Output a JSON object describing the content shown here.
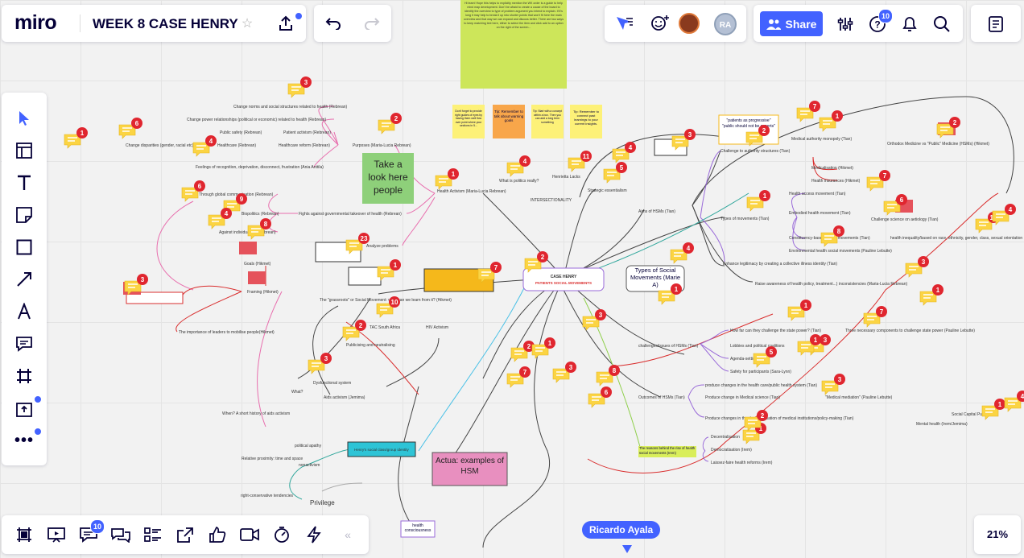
{
  "app": {
    "logo": "miro",
    "board_title": "WEEK 8 CASE HENRY",
    "zoom": "21%"
  },
  "top_right": {
    "share_label": "Share",
    "help_badge": "10",
    "avatar_initials": "RA"
  },
  "bottom_toolbar": {
    "comments_badge": "10"
  },
  "cursor": {
    "user": "Ricardo Ayala"
  },
  "left_toolbar": [
    "select-tool",
    "templates-tool",
    "text-tool",
    "sticky-note-tool",
    "shape-tool",
    "connection-line-tool",
    "pen-tool",
    "comment-tool",
    "frame-tool",
    "upload-tool",
    "more-tools"
  ],
  "board": {
    "center_title": "CASE HENRY",
    "center_subtitle": "PATIENTS SOCIAL MOVEMENTS",
    "green_note": "Take a look here people",
    "types_note": "Types of Social Movements (Marie A)",
    "actua_note": "Actua: examples of HSM",
    "privilege": "Privilege",
    "health_consciousness": "health consciousness",
    "henry_identity": "Henry's social class/group identity",
    "framing": "Framing (Hikmet)",
    "goals": "Goals (Hikmet)",
    "aids_activism": "Aids activism (Jemima)",
    "tac": "TAC South Africa",
    "hiv_activism": "HIV Activism",
    "publicising": "Publicising and neutralising",
    "dysfunctional": "Dysfunctional system",
    "analyze_problems": "Analyze problems",
    "intersectionality": "INTERSECTIONALITY",
    "strategic": "Strategic essentialism",
    "health_activism": "Health Activism (Maria-Lucia Rebrean)",
    "what_is_politics": "What is politics really?",
    "purposes": "Purposes (Maria-Lucia Rebrean)",
    "fights_against": "Fights against governmental takeover of health (Rebrean)",
    "grassroots": "The \"grassroots\" or Social Movement: what can we learn from it? (Hikmet)",
    "aims_hsm": "Aims of HSMs (Tian)",
    "types_movements": "Types of movements (Tian)",
    "challenges_hsm": "challenges/issues of HSMs (Tian)",
    "outcomes_hsm": "Outcomes of HSMs (Tian)",
    "challenge_authority": "Challenge to authority structures (Tian)",
    "orthodox": "Orthodox Medicine vs \"Public\" Medicine (HSMs) (Hikmet)",
    "medical_monopoly": "Medical authority monopoly (Tian)",
    "medicalisation": "Medicalisation (Hikmet)",
    "health_insurances": "Health insurances (Hikmet)",
    "health_access": "Health access movement (Tian)",
    "embodied": "Embodied health movement (Tian)",
    "constituency": "Constituency-based health movements (Tian)",
    "environmental": "Environmental health social movements (Pauline Lebutte)",
    "enhance_legitimacy": "Enhance legitimacy by creating a collective illness identity (Tian)",
    "raise_awareness": "Raise awareness of health policy, treatment...) inconsistencies (Maria-Lucia Rebrean)",
    "how_challenge_state": "How far can they challenge the state power? (Tian)",
    "three_components": "Three necessary components to challenge state power (Pauline Lebutte)",
    "lobbies": "Lobbies and political coalitions",
    "agenda": "Agenda-setting",
    "safety": "Safety for participants (Sara-Lynn)",
    "produce_public": "produce changes in the health care/public health system (Tian)",
    "produce_medical": "Produce change in Medical science (Tian)",
    "produce_policy": "Produce changes in the decentralisation of medical institutions/policy-making (Tian)",
    "decentralisation": "Decentralisation",
    "democratisation": "Democratisation (Irem)",
    "laissez_faire": "Laissez-faire health reforms (Irem)",
    "medical_mediation": "\"Medical mediation\" (Pauline Lebutte)",
    "reasons_behind": "The reasons behind the rise of health social movements (Irem)",
    "challenge_science": "Challenge science on aetiology (Tian)",
    "health_inequality": "health inequality/based on race, ethnicity, gender, class, sexual orientation",
    "mental_health": "Mental health (Irem/Jemima)",
    "social_capital": "Social Capital Putnam",
    "patient_progressive": "\"patients as progressive\" \"public should not be experts\"",
    "change_norms": "Change norms and social structures related to health (Rebrean)",
    "change_power": "Change power relationships (political or economic) related to health (Rebrean)",
    "public_safety": "Public safety (Rebrean)",
    "patient_activism": "Patient activism (Rebrean)",
    "healthcare_rebrean": "Healthcare (Rebrean)",
    "healthcare_reform": "Healthcare reform (Rebrean)",
    "feelings": "Feelings of recognition, deprivation, disconnect, frustration (Ania Anttila)",
    "change_disparities": "Change disparities (gender, racial etc)",
    "importance_leaders": "The importance of leaders to mobilise people(Hikmet)",
    "when_aids": "When? A short history of aids activism",
    "what_q": "What?",
    "relative_proximity": "Relative proximity: time and space",
    "nonactivism": "nonactivism",
    "political_apathy": "political apathy",
    "right_conservative": "right-conservative tendencies",
    "henriettas": "Henrietta Lacks",
    "biopolitics": "Biopolitics (Rebrean)",
    "against_individualism": "Against individualism (Rebrean)",
    "through_global": "Through global communication (Rebrean)",
    "instruction_text": "Hi team! Hope this helps to explicitly mention the WK order is a guide to help mind map development. Don't be afraid to create a cause of the board to identify the overview to type of problem argument you intend to explain. If it's long it may help to break it up into shorter points that won't fit here the main overview and that way we can expand and discuss better. There are two ways to keep matching text here, either to select the item and click add to an option on the right of the screen...",
    "tip1": "Don't forget to provide right guides of eyes by having them well flow over point where your sections in 5...",
    "tip2": "Tip: Remember to talk about warning goals",
    "tip3": "Tip: Start with a concept within a box. Then you can add a long term something",
    "tip4": "Tip: Remember to connect past learnings to your current insights.",
    "comment_counts": [
      "3",
      "1",
      "6",
      "4",
      "2",
      "9",
      "6",
      "4",
      "8",
      "3",
      "23",
      "1",
      "7",
      "2",
      "10",
      "2",
      "3",
      "1",
      "4",
      "11",
      "5",
      "3",
      "4",
      "7",
      "1",
      "2",
      "7",
      "6",
      "10",
      "4",
      "8",
      "1",
      "2",
      "4",
      "1",
      "3",
      "2",
      "1",
      "7",
      "3",
      "8",
      "6",
      "1",
      "7",
      "3",
      "1",
      "5",
      "1",
      "2",
      "3",
      "1",
      "4",
      "1",
      "3"
    ]
  }
}
